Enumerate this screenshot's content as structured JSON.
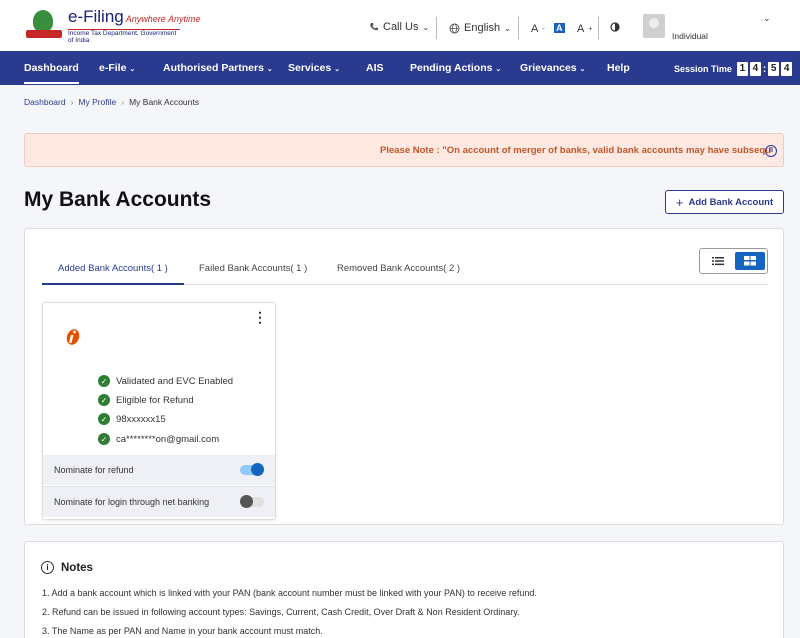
{
  "header": {
    "brand_title": "e-Filing",
    "brand_tagline": "Anywhere Anytime",
    "brand_subtitle": "Income Tax Department, Government of India",
    "call_us": "Call Us",
    "language": "English",
    "font_decrease": "A",
    "font_reset": "A",
    "font_increase": "A",
    "user_type": "Individual"
  },
  "nav": {
    "items": [
      {
        "label": "Dashboard"
      },
      {
        "label": "e-File"
      },
      {
        "label": "Authorised Partners"
      },
      {
        "label": "Services"
      },
      {
        "label": "AIS"
      },
      {
        "label": "Pending Actions"
      },
      {
        "label": "Grievances"
      },
      {
        "label": "Help"
      }
    ],
    "session_label": "Session Time",
    "session_digits": [
      "1",
      "4",
      "5",
      "4"
    ]
  },
  "breadcrumb": [
    "Dashboard",
    "My Profile",
    "My Bank Accounts"
  ],
  "notice": {
    "text": "Please Note : \"On account of merger of banks, valid bank accounts may have subsequ"
  },
  "page": {
    "title": "My Bank Accounts",
    "add_button": "Add Bank Account"
  },
  "tabs": [
    {
      "label": "Added Bank Accounts( 1 )"
    },
    {
      "label": "Failed Bank Accounts( 1 )"
    },
    {
      "label": "Removed Bank Accounts( 2 )"
    }
  ],
  "card": {
    "features": [
      "Validated and EVC Enabled",
      "Eligible for Refund",
      "98xxxxxx15",
      "ca********on@gmail.com"
    ],
    "refund_label": "Nominate for refund",
    "refund_on": true,
    "login_label": "Nominate for login through net banking",
    "login_on": false
  },
  "notes": {
    "title": "Notes",
    "items": [
      "1. Add a bank account which is linked with your PAN (bank account number must be linked with your PAN) to receive refund.",
      "2. Refund can be issued in following account types: Savings, Current, Cash Credit, Over Draft & Non Resident Ordinary.",
      "3. The Name as per PAN and Name in your bank account must match."
    ]
  },
  "colors": {
    "nav_bg": "#2a3a8f",
    "accent": "#1565c0",
    "success": "#2e7d32",
    "notice_bg": "#fde9e2",
    "notice_text": "#c0572a"
  }
}
